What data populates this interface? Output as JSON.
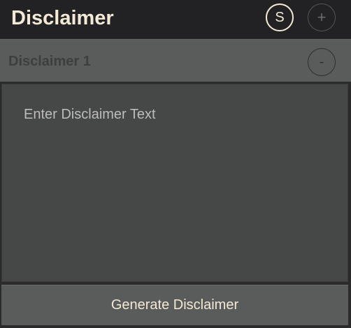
{
  "header": {
    "title": "Disclaimer",
    "s_button_label": "S",
    "add_button_label": "+"
  },
  "section": {
    "label": "Disclaimer 1",
    "remove_button_label": "-"
  },
  "disclaimer_input": {
    "placeholder": "Enter Disclaimer Text",
    "value": ""
  },
  "footer": {
    "generate_button_label": "Generate Disclaimer"
  }
}
